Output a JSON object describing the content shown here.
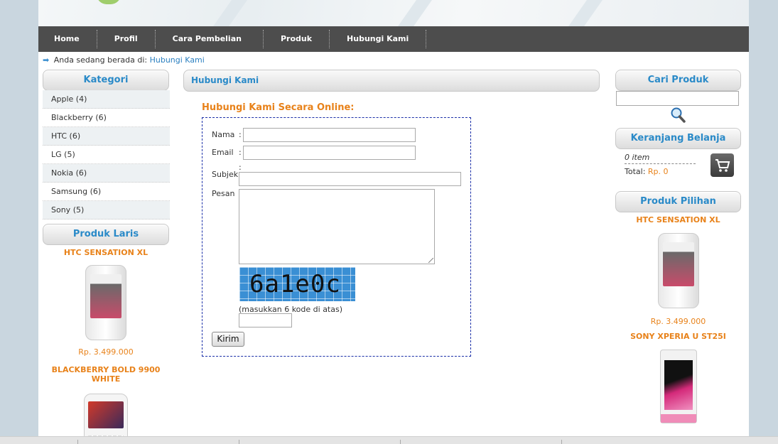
{
  "nav": [
    "Home",
    "Profil",
    "Cara Pembelian",
    "Produk",
    "Hubungi Kami"
  ],
  "breadcrumb": {
    "prefix": "Anda sedang berada di:",
    "current": "Hubungi Kami"
  },
  "left": {
    "kategori_title": "Kategori",
    "categories": [
      "Apple (4)",
      "Blackberry (6)",
      "HTC (6)",
      "LG (5)",
      "Nokia (6)",
      "Samsung (6)",
      "Sony (5)"
    ],
    "laris_title": "Produk Laris",
    "products": [
      {
        "name": "HTC SENSATION XL",
        "price": "Rp. 3.499.000"
      },
      {
        "name": "BLACKBERRY BOLD 9900 WHITE"
      }
    ]
  },
  "content": {
    "title": "Hubungi Kami",
    "heading": "Hubungi Kami Secara Online:",
    "form": {
      "nama_label": "Nama",
      "email_label": "Email",
      "subjek_label": "Subjek",
      "pesan_label": "Pesan",
      "colon": ":",
      "captcha_code": "6a1e0c",
      "captcha_hint": "(masukkan 6 kode di atas)",
      "submit": "Kirim"
    }
  },
  "right": {
    "search_title": "Cari Produk",
    "cart_title": "Keranjang Belanja",
    "cart_items": "0 item",
    "cart_total_label": "Total:",
    "cart_total_value": "Rp. 0",
    "pilihan_title": "Produk Pilihan",
    "products": [
      {
        "name": "HTC SENSATION XL",
        "price": "Rp. 3.499.000"
      },
      {
        "name": "SONY XPERIA U ST25I"
      }
    ]
  },
  "colors": {
    "accent_blue": "#2a8ac8",
    "accent_orange": "#e8821a",
    "nav_bg": "#4d4d4d"
  }
}
